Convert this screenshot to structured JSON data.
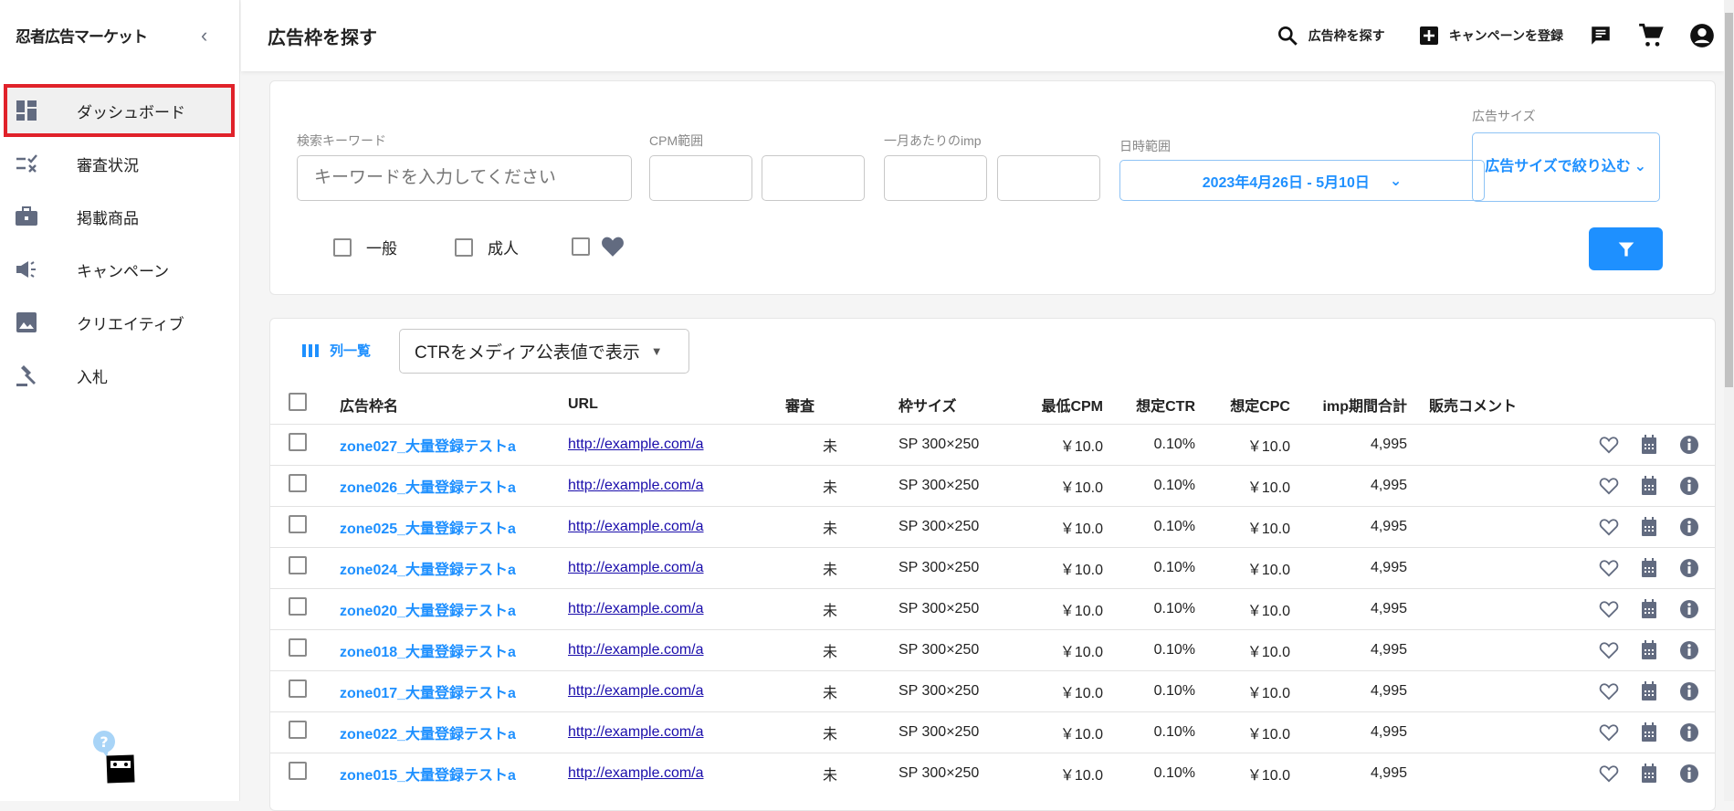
{
  "sidebar": {
    "logo": "忍者広告マーケット",
    "items": [
      {
        "label": "ダッシュボード",
        "icon": "dashboard-icon"
      },
      {
        "label": "審査状況",
        "icon": "checklist-icon"
      },
      {
        "label": "掲載商品",
        "icon": "briefcase-icon"
      },
      {
        "label": "キャンペーン",
        "icon": "megaphone-icon"
      },
      {
        "label": "クリエイティブ",
        "icon": "image-icon"
      },
      {
        "label": "入札",
        "icon": "gavel-icon"
      }
    ]
  },
  "header": {
    "title": "広告枠を探す",
    "search_label": "広告枠を探す",
    "add_campaign_label": "キャンペーンを登録"
  },
  "filters": {
    "keyword_label": "検索キーワード",
    "keyword_placeholder": "キーワードを入力してください",
    "keyword_value": "",
    "cpm_label": "CPM範囲",
    "imp_label": "一月あたりのimp",
    "date_label": "日時範囲",
    "date_value": "2023年4月26日 - 5月10日",
    "size_label": "広告サイズ",
    "size_value": "広告サイズで絞り込む",
    "checkboxes": [
      "一般",
      "成人"
    ]
  },
  "table": {
    "columns_button": "列一覧",
    "ctr_select": "CTRをメディア公表値で表示",
    "headers": [
      "広告枠名",
      "URL",
      "審査",
      "枠サイズ",
      "最低CPM",
      "想定CTR",
      "想定CPC",
      "imp期間合計",
      "販売コメント"
    ],
    "rows": [
      {
        "name": "zone027_大量登録テストa",
        "url": "http://example.com/a",
        "review": "未",
        "size": "SP 300×250",
        "cpm": "￥10.0",
        "ctr": "0.10%",
        "cpc": "￥10.0",
        "imp": "4,995",
        "comment": ""
      },
      {
        "name": "zone026_大量登録テストa",
        "url": "http://example.com/a",
        "review": "未",
        "size": "SP 300×250",
        "cpm": "￥10.0",
        "ctr": "0.10%",
        "cpc": "￥10.0",
        "imp": "4,995",
        "comment": ""
      },
      {
        "name": "zone025_大量登録テストa",
        "url": "http://example.com/a",
        "review": "未",
        "size": "SP 300×250",
        "cpm": "￥10.0",
        "ctr": "0.10%",
        "cpc": "￥10.0",
        "imp": "4,995",
        "comment": ""
      },
      {
        "name": "zone024_大量登録テストa",
        "url": "http://example.com/a",
        "review": "未",
        "size": "SP 300×250",
        "cpm": "￥10.0",
        "ctr": "0.10%",
        "cpc": "￥10.0",
        "imp": "4,995",
        "comment": ""
      },
      {
        "name": "zone020_大量登録テストa",
        "url": "http://example.com/a",
        "review": "未",
        "size": "SP 300×250",
        "cpm": "￥10.0",
        "ctr": "0.10%",
        "cpc": "￥10.0",
        "imp": "4,995",
        "comment": ""
      },
      {
        "name": "zone018_大量登録テストa",
        "url": "http://example.com/a",
        "review": "未",
        "size": "SP 300×250",
        "cpm": "￥10.0",
        "ctr": "0.10%",
        "cpc": "￥10.0",
        "imp": "4,995",
        "comment": ""
      },
      {
        "name": "zone017_大量登録テストa",
        "url": "http://example.com/a",
        "review": "未",
        "size": "SP 300×250",
        "cpm": "￥10.0",
        "ctr": "0.10%",
        "cpc": "￥10.0",
        "imp": "4,995",
        "comment": ""
      },
      {
        "name": "zone022_大量登録テストa",
        "url": "http://example.com/a",
        "review": "未",
        "size": "SP 300×250",
        "cpm": "￥10.0",
        "ctr": "0.10%",
        "cpc": "￥10.0",
        "imp": "4,995",
        "comment": ""
      },
      {
        "name": "zone015_大量登録テストa",
        "url": "http://example.com/a",
        "review": "未",
        "size": "SP 300×250",
        "cpm": "￥10.0",
        "ctr": "0.10%",
        "cpc": "￥10.0",
        "imp": "4,995",
        "comment": ""
      }
    ]
  },
  "colors": {
    "accent": "#1e90ff",
    "icon_gray": "#626b80",
    "highlight": "#e0222a"
  }
}
